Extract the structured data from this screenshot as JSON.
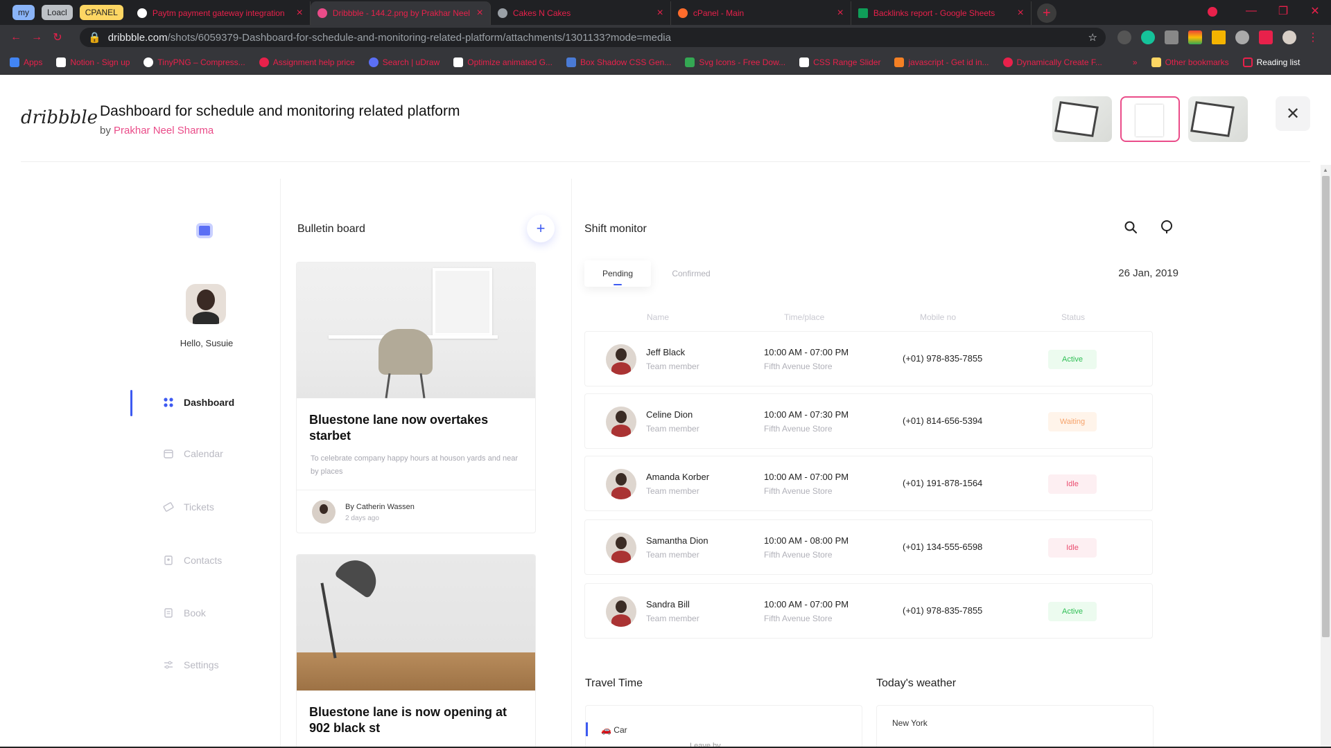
{
  "browser": {
    "tab_groups": [
      "my",
      "Loacl",
      "CPANEL"
    ],
    "tabs": [
      {
        "title": "Paytm payment gateway integration",
        "icon_color": "#ffffff",
        "active": false
      },
      {
        "title": "Dribbble - 144.2.png by Prakhar Neel",
        "icon_color": "#ea4c89",
        "active": true
      },
      {
        "title": "Cakes N Cakes",
        "icon_color": "#9aa0a6",
        "active": false
      },
      {
        "title": "cPanel - Main",
        "icon_color": "#ff6c2c",
        "active": false
      },
      {
        "title": "Backlinks report - Google Sheets",
        "icon_color": "#0f9d58",
        "active": false
      }
    ],
    "url_host": "dribbble.com",
    "url_path": "/shots/6059379-Dashboard-for-schedule-and-monitoring-related-platform/attachments/1301133?mode=media",
    "bookmarks": [
      {
        "label": "Apps",
        "color": "#4285f4"
      },
      {
        "label": "Notion - Sign up",
        "color": "#ffffff"
      },
      {
        "label": "TinyPNG – Compress...",
        "color": "#ffffff"
      },
      {
        "label": "Assignment help price",
        "color": "#e8214b"
      },
      {
        "label": "Search | uDraw",
        "color": "#5b6ff5"
      },
      {
        "label": "Optimize animated G...",
        "color": "#ffffff"
      },
      {
        "label": "Box Shadow CSS Gen...",
        "color": "#4a7bd6"
      },
      {
        "label": "Svg Icons - Free Dow...",
        "color": "#34a853"
      },
      {
        "label": "CSS Range Slider",
        "color": "#ffffff"
      },
      {
        "label": "javascript - Get id in...",
        "color": "#f48024"
      },
      {
        "label": "Dynamically Create F...",
        "color": "#e8214b"
      }
    ],
    "other_bookmarks": "Other bookmarks",
    "reading_list": "Reading list"
  },
  "shot": {
    "logo": "dribbble",
    "title": "Dashboard for schedule and monitoring related platform",
    "by_prefix": "by",
    "author": "Prakhar Neel Sharma"
  },
  "sidebar": {
    "greeting": "Hello, Susuie",
    "items": [
      {
        "label": "Dashboard",
        "icon": "grid-icon"
      },
      {
        "label": "Calendar",
        "icon": "calendar-icon"
      },
      {
        "label": "Tickets",
        "icon": "ticket-icon"
      },
      {
        "label": "Contacts",
        "icon": "contacts-icon"
      },
      {
        "label": "Book",
        "icon": "book-icon"
      },
      {
        "label": "Settings",
        "icon": "settings-icon"
      }
    ]
  },
  "bulletin": {
    "title": "Bulletin board",
    "cards": [
      {
        "title": "Bluestone lane now overtakes starbet",
        "desc": "To celebrate company happy hours at houson yards and near by places",
        "author": "By Catherin Wassen",
        "time": "2 days ago"
      },
      {
        "title": "Bluestone lane is now opening at 902 black st"
      }
    ]
  },
  "monitor": {
    "title": "Shift monitor",
    "tabs": [
      "Pending",
      "Confirmed"
    ],
    "date": "26 Jan, 2019",
    "columns": [
      "Name",
      "Time/place",
      "Mobile no",
      "Status"
    ],
    "rows": [
      {
        "name": "Jeff Black",
        "role": "Team member",
        "time": "10:00 AM - 07:00 PM",
        "place": "Fifth Avenue Store",
        "mobile": "(+01) 978-835-7855",
        "status": "Active"
      },
      {
        "name": "Celine Dion",
        "role": "Team member",
        "time": "10:00 AM - 07:30 PM",
        "place": "Fifth Avenue Store",
        "mobile": "(+01) 814-656-5394",
        "status": "Waiting"
      },
      {
        "name": "Amanda Korber",
        "role": "Team member",
        "time": "10:00 AM - 07:00 PM",
        "place": "Fifth Avenue Store",
        "mobile": "(+01) 191-878-1564",
        "status": "Idle"
      },
      {
        "name": "Samantha Dion",
        "role": "Team member",
        "time": "10:00 AM - 08:00 PM",
        "place": "Fifth Avenue Store",
        "mobile": "(+01) 134-555-6598",
        "status": "Idle"
      },
      {
        "name": "Sandra Bill",
        "role": "Team member",
        "time": "10:00 AM - 07:00 PM",
        "place": "Fifth Avenue Store",
        "mobile": "(+01) 978-835-7855",
        "status": "Active"
      }
    ],
    "travel_title": "Travel Time",
    "travel_mode": "Car",
    "travel_sub": "Leave by",
    "weather_title": "Today's weather",
    "weather_city": "New York"
  }
}
